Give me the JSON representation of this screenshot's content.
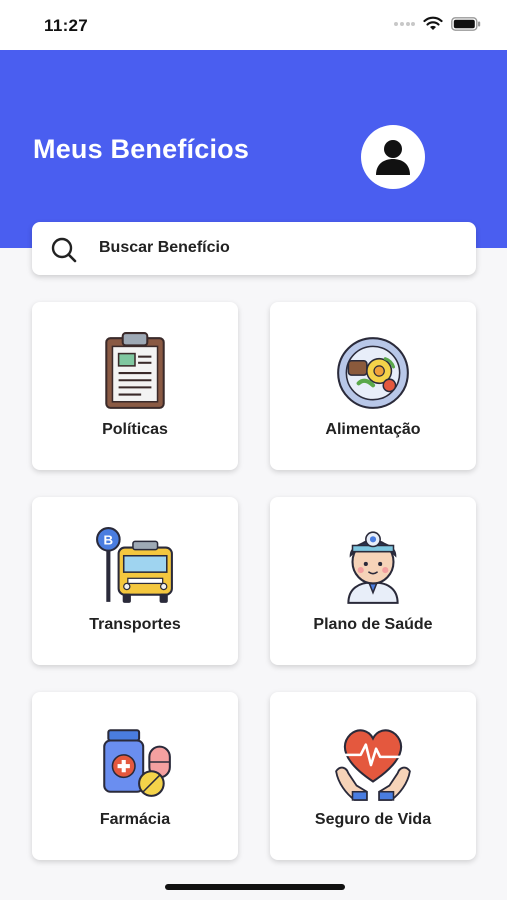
{
  "status_bar": {
    "time": "11:27"
  },
  "header": {
    "title": "Meus Benefícios"
  },
  "search": {
    "placeholder": "Buscar Benefício"
  },
  "cards": [
    {
      "label": "Políticas",
      "icon": "clipboard-icon"
    },
    {
      "label": "Alimentação",
      "icon": "food-plate-icon"
    },
    {
      "label": "Transportes",
      "icon": "bus-stop-icon"
    },
    {
      "label": "Plano de Saúde",
      "icon": "doctor-icon"
    },
    {
      "label": "Farmácia",
      "icon": "medicine-icon"
    },
    {
      "label": "Seguro de Vida",
      "icon": "heart-hands-icon"
    }
  ],
  "colors": {
    "header_bg": "#4a5ef0",
    "card_bg": "#ffffff",
    "page_bg": "#f7f7f9"
  }
}
